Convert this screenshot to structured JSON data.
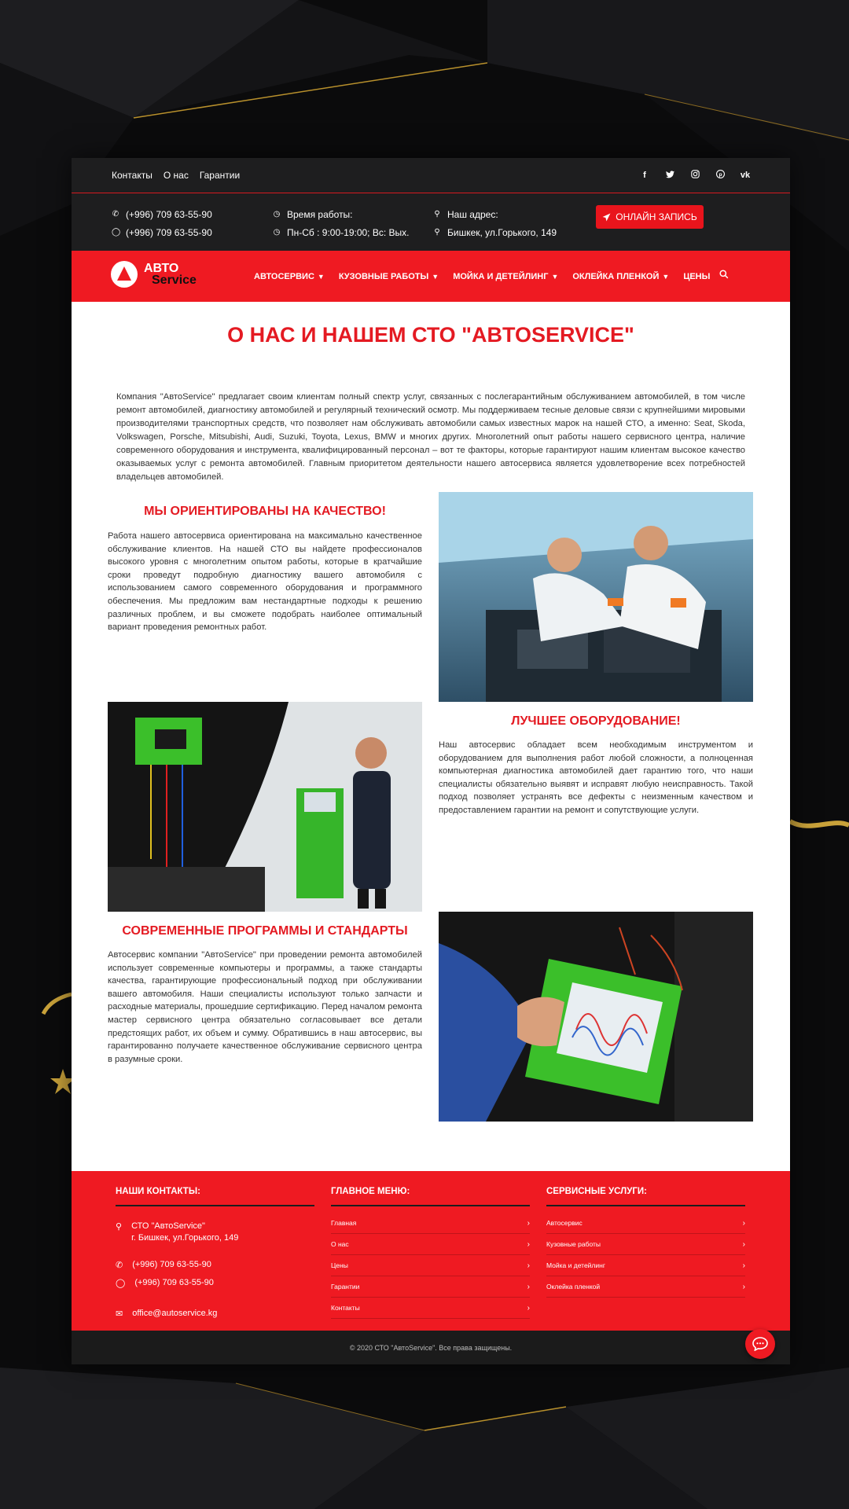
{
  "colors": {
    "accent": "#ef1a22",
    "dark": "#1e1e1f",
    "heading": "#e41a22"
  },
  "topbar": {
    "links": [
      "Контакты",
      "О нас",
      "Гарантии"
    ],
    "socials": [
      "facebook-icon",
      "twitter-icon",
      "instagram-icon",
      "pinterest-icon",
      "vk-icon"
    ]
  },
  "info": {
    "phone1": "(+996) 709 63-55-90",
    "phone2": "(+996) 709 63-55-90",
    "hours_label": "Время работы:",
    "hours": "Пн-Сб : 9:00-19:00; Вс: Вых.",
    "address_label": "Наш адрес:",
    "address": "Бишкек, ул.Горького, 149",
    "book_button": "ОНЛАЙН ЗАПИСЬ"
  },
  "logo": {
    "line1": "АВТО",
    "line2": "Service"
  },
  "nav": [
    {
      "label": "АВТОСЕРВИС",
      "dropdown": true
    },
    {
      "label": "КУЗОВНЫЕ РАБОТЫ",
      "dropdown": true
    },
    {
      "label": "МОЙКА И ДЕТЕЙЛИНГ",
      "dropdown": true
    },
    {
      "label": "ОКЛЕЙКА ПЛЕНКОЙ",
      "dropdown": true
    },
    {
      "label": "ЦЕНЫ",
      "dropdown": false
    }
  ],
  "main": {
    "title": "О НАС И НАШЕМ СТО \"ABTOSERVICE\"",
    "intro": "Компания \"АвтоService\" предлагает своим клиентам полный спектр услуг, связанных с послегарантийным обслуживанием автомобилей, в том числе ремонт автомобилей, диагностику автомобилей и регулярный технический осмотр. Мы поддерживаем тесные деловые связи с крупнейшими мировыми производителями транспортных средств, что позволяет нам обслуживать автомобили самых известных марок на нашей СТО, а именно: Seat, Skoda, Volkswagen, Porsche, Mitsubishi, Audi, Suzuki, Toyota, Lexus, BMW и многих других. Многолетний опыт работы нашего сервисного центра, наличие современного оборудования и инструмента, квалифицированный персонал – вот те факторы, которые гарантируют нашим клиентам высокое качество оказываемых услуг с ремонта автомобилей. Главным приоритетом деятельности нашего автосервиса является удовлетворение всех потребностей владельцев автомобилей.",
    "blocks": [
      {
        "title": "МЫ ОРИЕНТИРОВАНЫ НА КАЧЕСТВО!",
        "text": "Работа нашего автосервиса ориентирована на максимально качественное обслуживание клиентов. На нашей СТО вы найдете профессионалов высокого уровня с многолетним опытом работы, которые в кратчайшие сроки проведут подробную диагностику вашего автомобиля с использованием самого современного оборудования и программного обеспечения. Мы предложим вам нестандартные подходы к решению различных проблем, и вы сможете подобрать наиболее оптимальный вариант проведения ремонтных работ."
      },
      {
        "title": "ЛУЧШЕЕ ОБОРУДОВАНИЕ!",
        "text": "Наш автосервис обладает всем необходимым инструментом и оборудованием для выполнения работ любой сложности, а полноценная компьютерная диагностика автомобилей дает гарантию того, что наши специалисты обязательно выявят и исправят любую неисправность. Такой подход позволяет устранять все дефекты с неизменным качеством и предоставлением гарантии на ремонт и сопутствующие услуги."
      },
      {
        "title": "СОВРЕМЕННЫЕ ПРОГРАММЫ И СТАНДАРТЫ",
        "text": "Автосервис компании \"АвтоService\" при проведении ремонта автомобилей использует современные компьютеры и программы, а также стандарты качества, гарантирующие профессиональный подход при обслуживании вашего автомобиля. Наши специалисты используют только запчасти и расходные материалы, прошедшие сертификацию. Перед началом ремонта мастер сервисного центра обязательно согласовывает все детали предстоящих работ, их объем и сумму. Обратившись в наш автосервис, вы гарантированно получаете качественное обслуживание сервисного центра в разумные сроки."
      }
    ]
  },
  "footer": {
    "contacts_title": "НАШИ КОНТАКТЫ:",
    "company": "СТО \"АвтоService\"",
    "address": "г. Бишкек, ул.Горького, 149",
    "phone1": "(+996) 709 63-55-90",
    "phone2": "(+996) 709 63-55-90",
    "email": "office@autoservice.kg",
    "menu_title": "ГЛАВНОЕ МЕНЮ:",
    "menu": [
      "Главная",
      "О нас",
      "Цены",
      "Гарантии",
      "Контакты"
    ],
    "services_title": "СЕРВИСНЫЕ УСЛУГИ:",
    "services": [
      "Автосервис",
      "Кузовные работы",
      "Мойка и детейлинг",
      "Оклейка пленкой"
    ],
    "copyright": "© 2020 СТО \"АвтоService\". Все права защищены."
  }
}
